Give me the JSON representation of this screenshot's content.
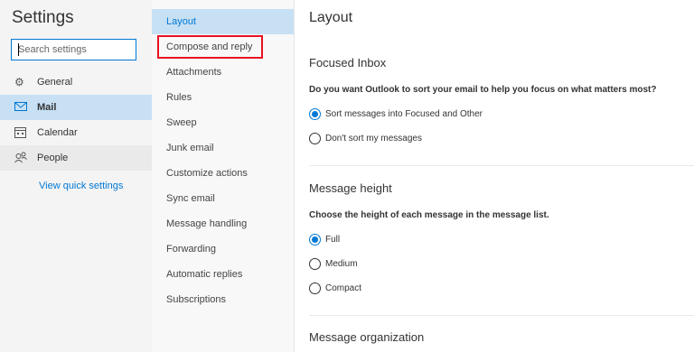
{
  "left": {
    "title": "Settings",
    "search_placeholder": "Search settings",
    "items": [
      {
        "label": "General",
        "icon": "gear-icon"
      },
      {
        "label": "Mail",
        "icon": "mail-icon"
      },
      {
        "label": "Calendar",
        "icon": "calendar-icon"
      },
      {
        "label": "People",
        "icon": "people-icon"
      }
    ],
    "quick_link": "View quick settings"
  },
  "middle": {
    "items": [
      "Layout",
      "Compose and reply",
      "Attachments",
      "Rules",
      "Sweep",
      "Junk email",
      "Customize actions",
      "Sync email",
      "Message handling",
      "Forwarding",
      "Automatic replies",
      "Subscriptions"
    ],
    "selected": "Layout"
  },
  "main": {
    "title": "Layout",
    "focused": {
      "heading": "Focused Inbox",
      "question": "Do you want Outlook to sort your email to help you focus on what matters most?",
      "options": [
        "Sort messages into Focused and Other",
        "Don't sort my messages"
      ],
      "selected": "Sort messages into Focused and Other"
    },
    "height": {
      "heading": "Message height",
      "question": "Choose the height of each message in the message list.",
      "options": [
        "Full",
        "Medium",
        "Compact"
      ],
      "selected": "Full"
    },
    "organization": {
      "heading": "Message organization"
    }
  },
  "colors": {
    "accent": "#0078d4",
    "highlight": "#c7e0f4",
    "callout": "#e81123"
  }
}
